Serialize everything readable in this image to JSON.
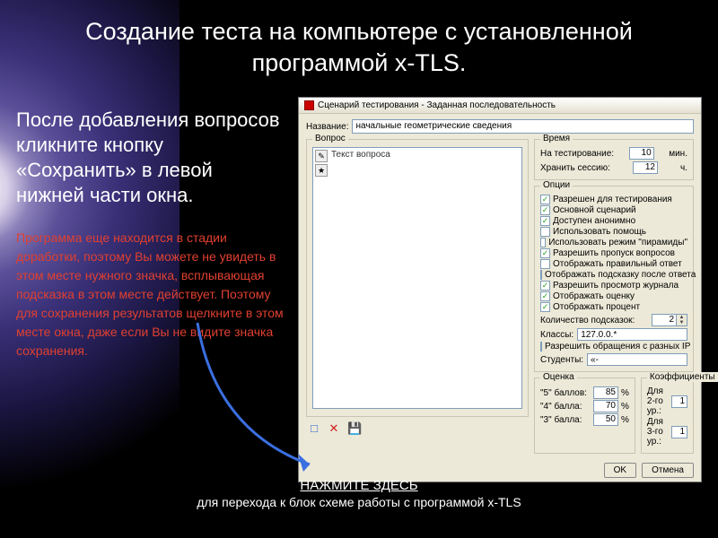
{
  "slide": {
    "title": "Создание теста на компьютере с установленной программой x-TLS.",
    "body": "После добавления вопросов кликните кнопку «Сохранить» в левой нижней части окна.",
    "redNote": "Программа еще находится в стадии доработки, поэтому Вы можете не увидеть в этом месте нужного значка, всплывающая подсказка в этом месте действует. Поэтому для сохранения результатов щелкните в этом месте окна, даже если Вы не видите значка сохранения.",
    "footerLink": "НАЖМИТЕ ЗДЕСЬ",
    "footerSub": "для перехода к блок схеме работы с программой x-TLS"
  },
  "dialog": {
    "title": "Сценарий тестирования - Заданная последовательность",
    "nameLabel": "Название:",
    "nameValue": "начальные геометрические сведения",
    "question": {
      "legend": "Вопрос",
      "placeholder": "Текст вопроса"
    },
    "time": {
      "legend": "Время",
      "l1": "На тестирование:",
      "v1": "10",
      "u1": "мин.",
      "l2": "Хранить сессию:",
      "v2": "12",
      "u2": "ч."
    },
    "options": {
      "legend": "Опции",
      "items": [
        {
          "label": "Разрешен для тестирования",
          "checked": true
        },
        {
          "label": "Основной сценарий",
          "checked": true
        },
        {
          "label": "Доступен анонимно",
          "checked": true
        },
        {
          "label": "Использовать помощь",
          "checked": false
        },
        {
          "label": "Использовать режим \"пирамиды\"",
          "checked": false
        },
        {
          "label": "Разрешить пропуск вопросов",
          "checked": true
        },
        {
          "label": "Отображать правильный ответ",
          "checked": false
        },
        {
          "label": "Отображать подсказку после ответа",
          "checked": false
        },
        {
          "label": "Разрешить просмотр журнала",
          "checked": true
        },
        {
          "label": "Отображать оценку",
          "checked": true
        },
        {
          "label": "Отображать процент",
          "checked": true
        }
      ],
      "hintsLabel": "Количество подсказок:",
      "hintsValue": "2",
      "classesLabel": "Классы:",
      "classesValue": "127.0.0.*",
      "allowIP": {
        "label": "Разрешить обращения с разных IP",
        "checked": false
      },
      "studentsLabel": "Студенты:",
      "studentsValue": "«-"
    },
    "grades": {
      "legend": "Оценка",
      "r5": {
        "lbl": "\"5\" баллов:",
        "v": "85",
        "u": "%"
      },
      "r4": {
        "lbl": "\"4\" балла:",
        "v": "70",
        "u": "%"
      },
      "r3": {
        "lbl": "\"3\" балла:",
        "v": "50",
        "u": "%"
      }
    },
    "coeff": {
      "legend": "Коэффициенты",
      "r2": {
        "lbl": "Для 2-го ур.:",
        "v": "1"
      },
      "r3": {
        "lbl": "Для 3-го ур.:",
        "v": "1"
      }
    },
    "buttons": {
      "ok": "OK",
      "cancel": "Отмена"
    },
    "bottomIcons": {
      "save": "💾",
      "delete": "✕",
      "new": "□"
    }
  }
}
